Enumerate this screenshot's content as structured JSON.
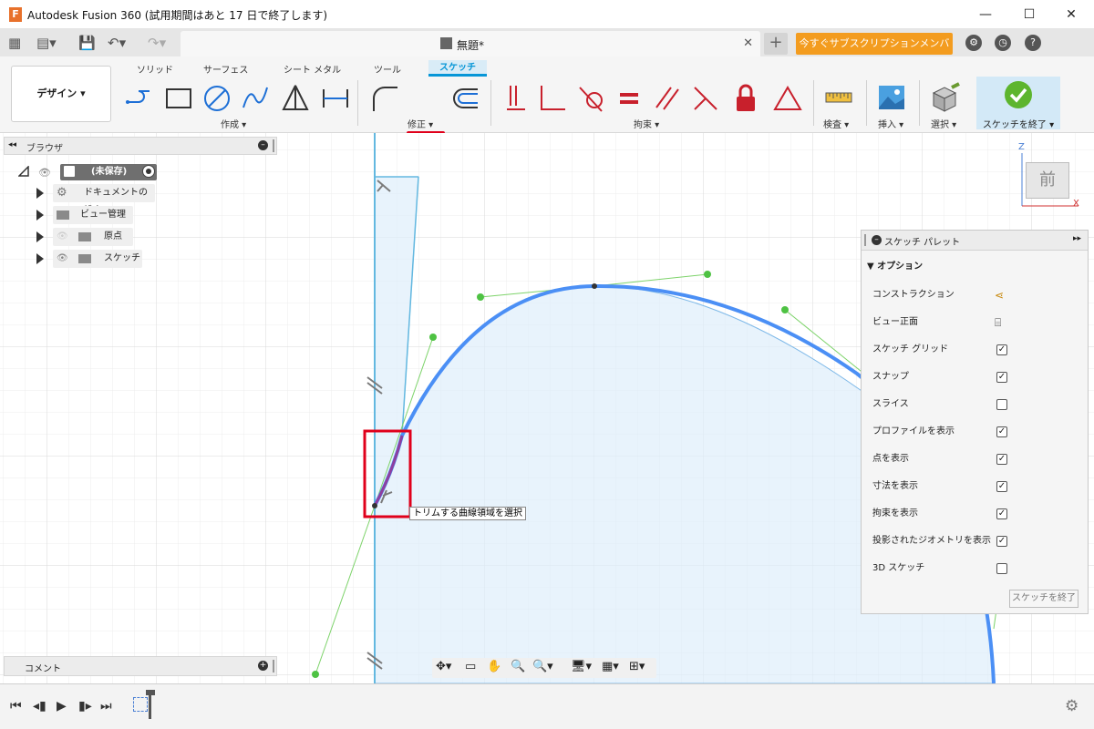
{
  "window": {
    "logo": "F",
    "title": "Autodesk Fusion 360 (試用期間はあと 17 日で終了します)"
  },
  "tabbar": {
    "doc_title": "無題*",
    "new_tab": "+",
    "promo": "今すぐサブスクリプションメンバーに..."
  },
  "ribbon": {
    "workspace": "デザイン",
    "tabs": [
      "ソリッド",
      "サーフェス",
      "シート メタル",
      "ツール",
      "スケッチ"
    ],
    "active_tab": "スケッチ",
    "groups": {
      "create": "作成",
      "modify": "修正",
      "constraints": "拘束",
      "inspect": "検査",
      "insert": "挿入",
      "select": "選択",
      "finish": "スケッチを終了"
    }
  },
  "browser": {
    "title": "ブラウザ",
    "root": "(未保存)",
    "items": [
      "ドキュメントの設定",
      "ビュー管理",
      "原点",
      "スケッチ"
    ]
  },
  "viewcube": {
    "face": "前",
    "axis_z": "Z",
    "axis_x": "X"
  },
  "palette": {
    "title": "スケッチ パレット",
    "section": "オプション",
    "rows": [
      {
        "label": "コンストラクション",
        "kind": "icon",
        "icon": "construction-icon"
      },
      {
        "label": "ビュー正面",
        "kind": "icon",
        "icon": "look-at-icon"
      },
      {
        "label": "スケッチ グリッド",
        "kind": "check",
        "checked": true
      },
      {
        "label": "スナップ",
        "kind": "check",
        "checked": true
      },
      {
        "label": "スライス",
        "kind": "check",
        "checked": false
      },
      {
        "label": "プロファイルを表示",
        "kind": "check",
        "checked": true
      },
      {
        "label": "点を表示",
        "kind": "check",
        "checked": true
      },
      {
        "label": "寸法を表示",
        "kind": "check",
        "checked": true
      },
      {
        "label": "拘束を表示",
        "kind": "check",
        "checked": true
      },
      {
        "label": "投影されたジオメトリを表示",
        "kind": "check",
        "checked": true
      },
      {
        "label": "3D スケッチ",
        "kind": "check",
        "checked": false
      }
    ],
    "finish_button": "スケッチを終了"
  },
  "tooltip": "トリムする曲線領域を選択",
  "comments": {
    "title": "コメント"
  },
  "colors": {
    "accent": "#0696d7",
    "highlight": "#e0001b",
    "curve": "#4b8ff5",
    "promo": "#f39c1f"
  }
}
